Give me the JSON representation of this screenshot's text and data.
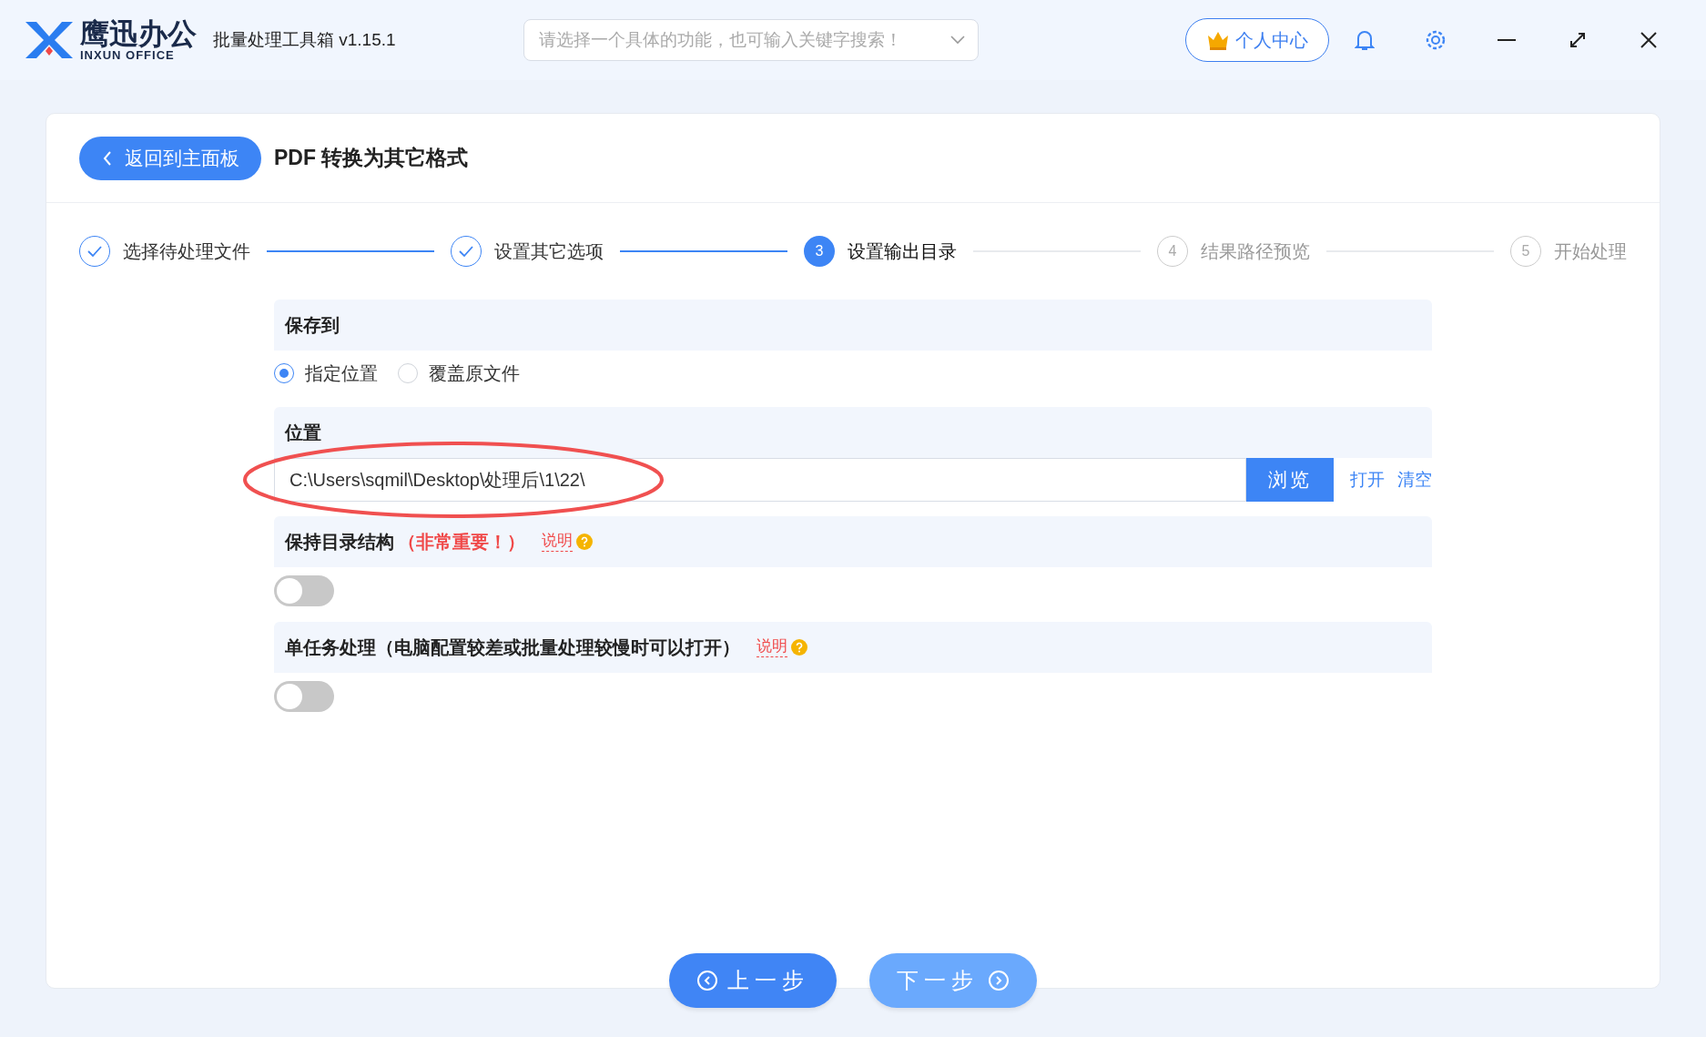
{
  "app": {
    "logo_name": "鹰迅办公",
    "logo_sub": "INXUN OFFICE",
    "title": "批量处理工具箱 v1.15.1"
  },
  "search": {
    "placeholder": "请选择一个具体的功能，也可输入关键字搜索！"
  },
  "user_button": "个人中心",
  "back_button": "返回到主面板",
  "page_title": "PDF 转换为其它格式",
  "steps": [
    {
      "label": "选择待处理文件",
      "completed": true,
      "current": false
    },
    {
      "label": "设置其它选项",
      "completed": true,
      "current": false
    },
    {
      "number": "3",
      "label": "设置输出目录",
      "completed": false,
      "current": true
    },
    {
      "number": "4",
      "label": "结果路径预览",
      "completed": false,
      "current": false
    },
    {
      "number": "5",
      "label": "开始处理",
      "completed": false,
      "current": false
    }
  ],
  "save_to": {
    "heading": "保存到",
    "options": [
      {
        "label": "指定位置",
        "selected": true
      },
      {
        "label": "覆盖原文件",
        "selected": false
      }
    ]
  },
  "location": {
    "heading": "位置",
    "value": "C:\\Users\\sqmil\\Desktop\\处理后\\1\\22\\",
    "browse": "浏览",
    "open": "打开",
    "clear": "清空",
    "highlighted": true
  },
  "toggles": [
    {
      "heading": "保持目录结构",
      "note": "（非常重要！）",
      "help": "说明",
      "on": false
    },
    {
      "heading": "单任务处理（电脑配置较差或批量处理较慢时可以打开）",
      "help": "说明",
      "on": false
    }
  ],
  "nav": {
    "prev": "上一步",
    "next": "下一步"
  }
}
